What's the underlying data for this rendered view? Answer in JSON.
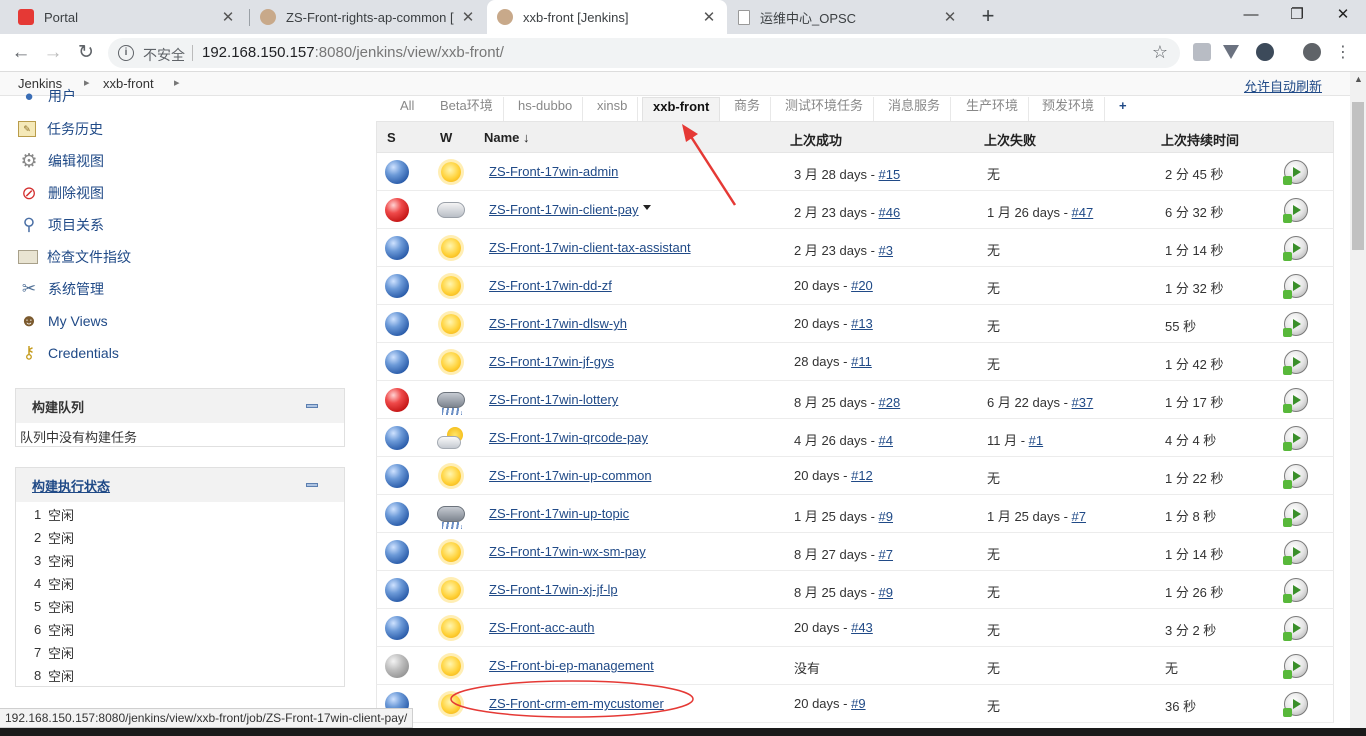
{
  "browser": {
    "tabs": [
      {
        "title": "Portal",
        "icon_color": "#e53935",
        "active": false
      },
      {
        "title": "ZS-Front-rights-ap-common [",
        "icon_color": "#8d6e63",
        "active": false
      },
      {
        "title": "xxb-front [Jenkins]",
        "icon_color": "#8d6e63",
        "active": true
      },
      {
        "title": "运维中心_OPSC",
        "icon_color": "#ffffff",
        "active": false
      }
    ],
    "new_tab": "+",
    "window_controls": {
      "minimize": "—",
      "restore": "❐",
      "close": "✕"
    },
    "nav": {
      "back": "←",
      "forward": "→",
      "reload": "↻"
    },
    "security_label": "不安全",
    "url_host": "192.168.150.157",
    "url_rest": ":8080/jenkins/view/xxb-front/",
    "status_url": "192.168.150.157:8080/jenkins/view/xxb-front/job/ZS-Front-17win-client-pay/"
  },
  "breadcrumb": {
    "items": [
      "Jenkins",
      "xxb-front"
    ],
    "auto_refresh": "允许自动刷新"
  },
  "sidebar": {
    "partial_item": "用户",
    "tasks": [
      {
        "label": "任务历史",
        "icon": "notepad-icon"
      },
      {
        "label": "编辑视图",
        "icon": "gear-icon"
      },
      {
        "label": "删除视图",
        "icon": "no-entry-icon"
      },
      {
        "label": "项目关系",
        "icon": "magnifier-icon"
      },
      {
        "label": "检查文件指纹",
        "icon": "fingerprint-icon"
      },
      {
        "label": "系统管理",
        "icon": "tools-icon"
      },
      {
        "label": "My Views",
        "icon": "people-icon"
      },
      {
        "label": "Credentials",
        "icon": "keys-icon"
      }
    ],
    "queue": {
      "title": "构建队列",
      "empty_text": "队列中没有构建任务"
    },
    "executors": {
      "title": "构建执行状态",
      "rows": [
        {
          "num": "1",
          "status": "空闲"
        },
        {
          "num": "2",
          "status": "空闲"
        },
        {
          "num": "3",
          "status": "空闲"
        },
        {
          "num": "4",
          "status": "空闲"
        },
        {
          "num": "5",
          "status": "空闲"
        },
        {
          "num": "6",
          "status": "空闲"
        },
        {
          "num": "7",
          "status": "空闲"
        },
        {
          "num": "8",
          "status": "空闲"
        }
      ]
    }
  },
  "view_tabs": [
    "All",
    "Beta环境",
    "hs-dubbo",
    "xinsb",
    "xxb-front",
    "商务",
    "测试环境任务",
    "消息服务",
    "生产环境",
    "预发环境",
    "+"
  ],
  "active_view": "xxb-front",
  "table": {
    "headers": {
      "s": "S",
      "w": "W",
      "name": "Name ↓",
      "last_success": "上次成功",
      "last_failure": "上次失败",
      "last_duration": "上次持续时间"
    },
    "rows": [
      {
        "status": "blue",
        "weather": "sunny",
        "name": "ZS-Front-17win-admin",
        "succ_text": "3 月 28 days - ",
        "succ_link": "#15",
        "fail_text": "无",
        "fail_link": "",
        "duration": "2 分 45 秒"
      },
      {
        "status": "red",
        "weather": "cloudy",
        "name": "ZS-Front-17win-client-pay",
        "dropdown": true,
        "succ_text": "2 月 23 days - ",
        "succ_link": "#46",
        "fail_text": "1 月 26 days - ",
        "fail_link": "#47",
        "duration": "6 分 32 秒"
      },
      {
        "status": "blue",
        "weather": "sunny",
        "name": "ZS-Front-17win-client-tax-assistant",
        "succ_text": "2 月 23 days - ",
        "succ_link": "#3",
        "fail_text": "无",
        "fail_link": "",
        "duration": "1 分 14 秒"
      },
      {
        "status": "blue",
        "weather": "sunny",
        "name": "ZS-Front-17win-dd-zf",
        "succ_text": "20 days - ",
        "succ_link": "#20",
        "fail_text": "无",
        "fail_link": "",
        "duration": "1 分 32 秒"
      },
      {
        "status": "blue",
        "weather": "sunny",
        "name": "ZS-Front-17win-dlsw-yh",
        "succ_text": "20 days - ",
        "succ_link": "#13",
        "fail_text": "无",
        "fail_link": "",
        "duration": "55 秒"
      },
      {
        "status": "blue",
        "weather": "sunny",
        "name": "ZS-Front-17win-jf-gys",
        "succ_text": "28 days - ",
        "succ_link": "#11",
        "fail_text": "无",
        "fail_link": "",
        "duration": "1 分 42 秒"
      },
      {
        "status": "red",
        "weather": "storm",
        "name": "ZS-Front-17win-lottery",
        "succ_text": "8 月 25 days - ",
        "succ_link": "#28",
        "fail_text": "6 月 22 days - ",
        "fail_link": "#37",
        "duration": "1 分 17 秒"
      },
      {
        "status": "blue",
        "weather": "partly",
        "name": "ZS-Front-17win-qrcode-pay",
        "succ_text": "4 月 26 days - ",
        "succ_link": "#4",
        "fail_text": "11 月 - ",
        "fail_link": "#1",
        "duration": "4 分 4 秒"
      },
      {
        "status": "blue",
        "weather": "sunny",
        "name": "ZS-Front-17win-up-common",
        "succ_text": "20 days - ",
        "succ_link": "#12",
        "fail_text": "无",
        "fail_link": "",
        "duration": "1 分 22 秒"
      },
      {
        "status": "blue",
        "weather": "storm",
        "name": "ZS-Front-17win-up-topic",
        "succ_text": "1 月 25 days - ",
        "succ_link": "#9",
        "fail_text": "1 月 25 days - ",
        "fail_link": "#7",
        "duration": "1 分 8 秒"
      },
      {
        "status": "blue",
        "weather": "sunny",
        "name": "ZS-Front-17win-wx-sm-pay",
        "succ_text": "8 月 27 days - ",
        "succ_link": "#7",
        "fail_text": "无",
        "fail_link": "",
        "duration": "1 分 14 秒"
      },
      {
        "status": "blue",
        "weather": "sunny",
        "name": "ZS-Front-17win-xj-jf-lp",
        "succ_text": "8 月 25 days - ",
        "succ_link": "#9",
        "fail_text": "无",
        "fail_link": "",
        "duration": "1 分 26 秒"
      },
      {
        "status": "blue",
        "weather": "sunny",
        "name": "ZS-Front-acc-auth",
        "succ_text": "20 days - ",
        "succ_link": "#43",
        "fail_text": "无",
        "fail_link": "",
        "duration": "3 分 2 秒"
      },
      {
        "status": "grey",
        "weather": "sunny",
        "name": "ZS-Front-bi-ep-management",
        "succ_text": "没有",
        "succ_link": "",
        "fail_text": "无",
        "fail_link": "",
        "duration": "无"
      },
      {
        "status": "blue",
        "weather": "sunny",
        "name": "ZS-Front-crm-em-mycustomer",
        "succ_text": "20 days - ",
        "succ_link": "#9",
        "fail_text": "无",
        "fail_link": "",
        "duration": "36 秒"
      }
    ]
  },
  "colors": {
    "link": "#204a87",
    "annotation": "#e53935",
    "tab_bg": "#dee1e6"
  }
}
